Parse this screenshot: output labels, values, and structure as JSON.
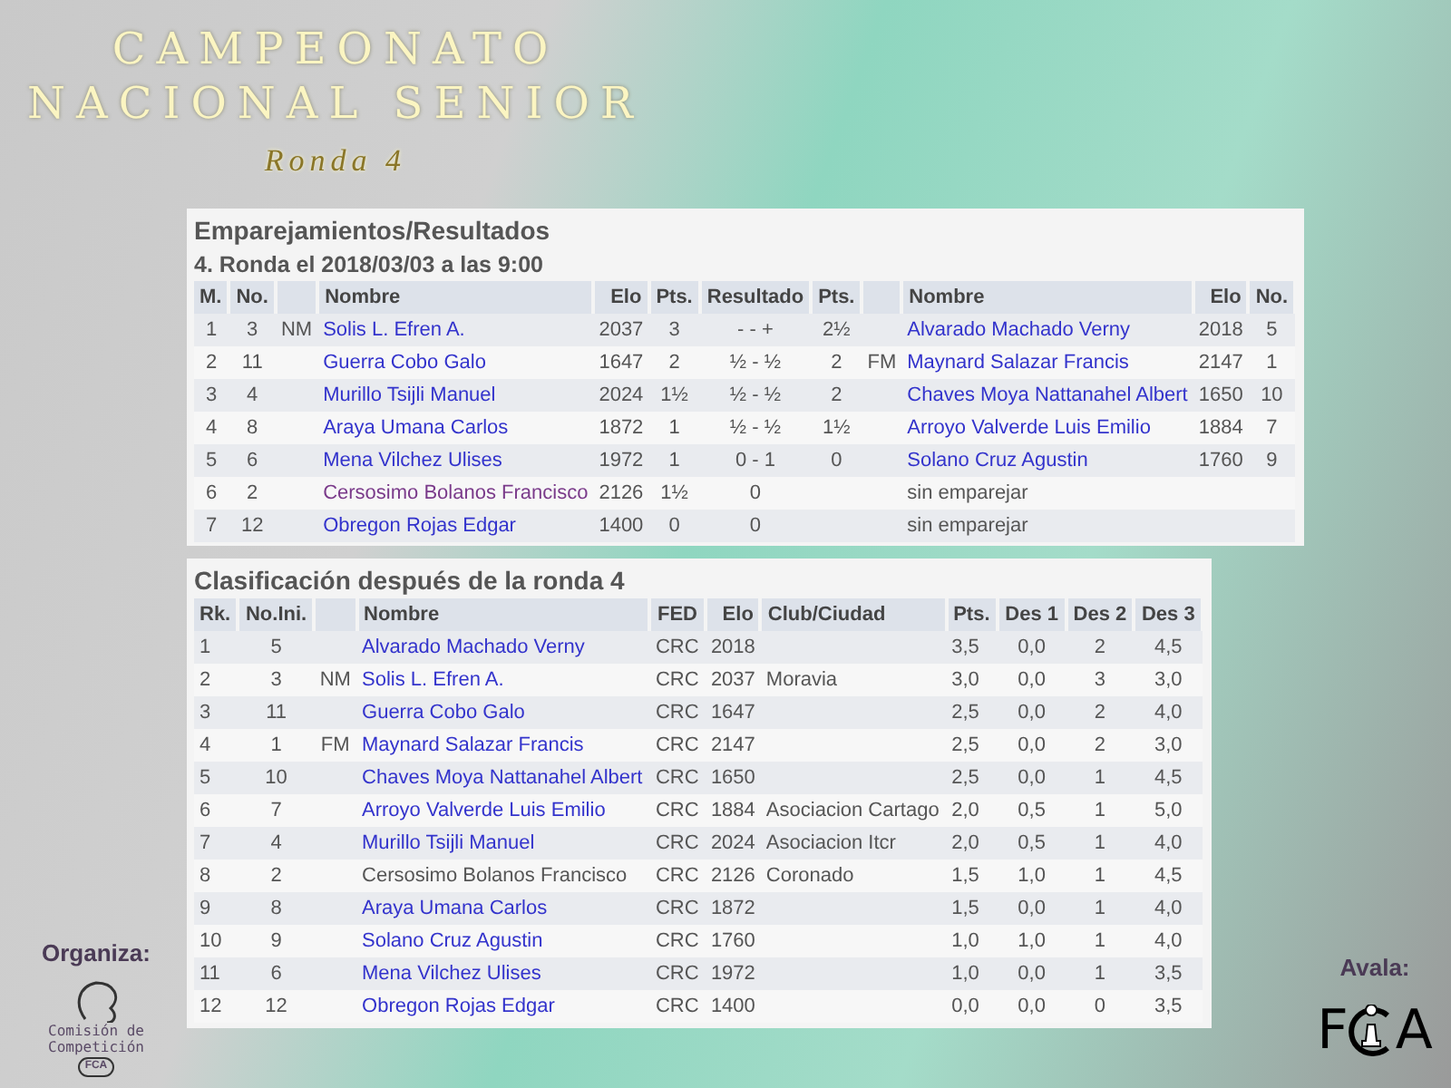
{
  "title": {
    "line1": "CAMPEONATO",
    "line2": "NACIONAL SENIOR",
    "subtitle": "Ronda 4"
  },
  "pairings": {
    "title": "Emparejamientos/Resultados",
    "subtitle": "4. Ronda el 2018/03/03 a las 9:00",
    "columns": [
      "M.",
      "No.",
      "",
      "Nombre",
      "Elo",
      "Pts.",
      "Resultado",
      "Pts.",
      "",
      "Nombre",
      "Elo",
      "No."
    ],
    "rows": [
      {
        "m": "1",
        "no": "3",
        "title": "NM",
        "name": {
          "text": "Solis L. Efren A.",
          "kind": "link"
        },
        "elo": "2037",
        "pts": "3",
        "result": "- - +",
        "pts2": "2½",
        "title2": "",
        "name2": {
          "text": "Alvarado Machado Verny",
          "kind": "link"
        },
        "elo2": "2018",
        "no2": "5"
      },
      {
        "m": "2",
        "no": "11",
        "title": "",
        "name": {
          "text": "Guerra Cobo Galo",
          "kind": "link"
        },
        "elo": "1647",
        "pts": "2",
        "result": "½ - ½",
        "pts2": "2",
        "title2": "FM",
        "name2": {
          "text": "Maynard Salazar Francis",
          "kind": "link"
        },
        "elo2": "2147",
        "no2": "1"
      },
      {
        "m": "3",
        "no": "4",
        "title": "",
        "name": {
          "text": "Murillo Tsijli Manuel",
          "kind": "link"
        },
        "elo": "2024",
        "pts": "1½",
        "result": "½ - ½",
        "pts2": "2",
        "title2": "",
        "name2": {
          "text": "Chaves Moya Nattanahel Albert",
          "kind": "link"
        },
        "elo2": "1650",
        "no2": "10"
      },
      {
        "m": "4",
        "no": "8",
        "title": "",
        "name": {
          "text": "Araya Umana Carlos",
          "kind": "link"
        },
        "elo": "1872",
        "pts": "1",
        "result": "½ - ½",
        "pts2": "1½",
        "title2": "",
        "name2": {
          "text": "Arroyo Valverde Luis Emilio",
          "kind": "link"
        },
        "elo2": "1884",
        "no2": "7"
      },
      {
        "m": "5",
        "no": "6",
        "title": "",
        "name": {
          "text": "Mena Vilchez Ulises",
          "kind": "link"
        },
        "elo": "1972",
        "pts": "1",
        "result": "0 - 1",
        "pts2": "0",
        "title2": "",
        "name2": {
          "text": "Solano Cruz Agustin",
          "kind": "link"
        },
        "elo2": "1760",
        "no2": "9"
      },
      {
        "m": "6",
        "no": "2",
        "title": "",
        "name": {
          "text": "Cersosimo Bolanos Francisco",
          "kind": "visited"
        },
        "elo": "2126",
        "pts": "1½",
        "result": "0",
        "pts2": "",
        "title2": "",
        "name2": {
          "text": "sin emparejar",
          "kind": "plain"
        },
        "elo2": "",
        "no2": ""
      },
      {
        "m": "7",
        "no": "12",
        "title": "",
        "name": {
          "text": "Obregon Rojas Edgar",
          "kind": "link"
        },
        "elo": "1400",
        "pts": "0",
        "result": "0",
        "pts2": "",
        "title2": "",
        "name2": {
          "text": "sin emparejar",
          "kind": "plain"
        },
        "elo2": "",
        "no2": ""
      }
    ]
  },
  "standings": {
    "title": "Clasificación después de la ronda 4",
    "columns": [
      "Rk.",
      "No.Ini.",
      "",
      "Nombre",
      "FED",
      "Elo",
      "Club/Ciudad",
      "Pts.",
      "Des 1",
      "Des 2",
      "Des 3"
    ],
    "rows": [
      {
        "rk": "1",
        "no": "5",
        "title": "",
        "name": {
          "text": "Alvarado Machado Verny",
          "kind": "link"
        },
        "fed": "CRC",
        "elo": "2018",
        "club": "",
        "pts": "3,5",
        "des1": "0,0",
        "des2": "2",
        "des3": "4,5"
      },
      {
        "rk": "2",
        "no": "3",
        "title": "NM",
        "name": {
          "text": "Solis L. Efren A.",
          "kind": "link"
        },
        "fed": "CRC",
        "elo": "2037",
        "club": "Moravia",
        "pts": "3,0",
        "des1": "0,0",
        "des2": "3",
        "des3": "3,0"
      },
      {
        "rk": "3",
        "no": "11",
        "title": "",
        "name": {
          "text": "Guerra Cobo Galo",
          "kind": "link"
        },
        "fed": "CRC",
        "elo": "1647",
        "club": "",
        "pts": "2,5",
        "des1": "0,0",
        "des2": "2",
        "des3": "4,0"
      },
      {
        "rk": "4",
        "no": "1",
        "title": "FM",
        "name": {
          "text": "Maynard Salazar Francis",
          "kind": "link"
        },
        "fed": "CRC",
        "elo": "2147",
        "club": "",
        "pts": "2,5",
        "des1": "0,0",
        "des2": "2",
        "des3": "3,0"
      },
      {
        "rk": "5",
        "no": "10",
        "title": "",
        "name": {
          "text": "Chaves Moya Nattanahel Albert",
          "kind": "link"
        },
        "fed": "CRC",
        "elo": "1650",
        "club": "",
        "pts": "2,5",
        "des1": "0,0",
        "des2": "1",
        "des3": "4,5"
      },
      {
        "rk": "6",
        "no": "7",
        "title": "",
        "name": {
          "text": "Arroyo Valverde Luis Emilio",
          "kind": "link"
        },
        "fed": "CRC",
        "elo": "1884",
        "club": "Asociacion Cartago",
        "pts": "2,0",
        "des1": "0,5",
        "des2": "1",
        "des3": "5,0"
      },
      {
        "rk": "7",
        "no": "4",
        "title": "",
        "name": {
          "text": "Murillo Tsijli Manuel",
          "kind": "link"
        },
        "fed": "CRC",
        "elo": "2024",
        "club": "Asociacion Itcr",
        "pts": "2,0",
        "des1": "0,5",
        "des2": "1",
        "des3": "4,0"
      },
      {
        "rk": "8",
        "no": "2",
        "title": "",
        "name": {
          "text": "Cersosimo Bolanos Francisco",
          "kind": "plain"
        },
        "fed": "CRC",
        "elo": "2126",
        "club": "Coronado",
        "pts": "1,5",
        "des1": "1,0",
        "des2": "1",
        "des3": "4,5"
      },
      {
        "rk": "9",
        "no": "8",
        "title": "",
        "name": {
          "text": "Araya Umana Carlos",
          "kind": "link"
        },
        "fed": "CRC",
        "elo": "1872",
        "club": "",
        "pts": "1,5",
        "des1": "0,0",
        "des2": "1",
        "des3": "4,0"
      },
      {
        "rk": "10",
        "no": "9",
        "title": "",
        "name": {
          "text": "Solano Cruz Agustin",
          "kind": "link"
        },
        "fed": "CRC",
        "elo": "1760",
        "club": "",
        "pts": "1,0",
        "des1": "1,0",
        "des2": "1",
        "des3": "4,0"
      },
      {
        "rk": "11",
        "no": "6",
        "title": "",
        "name": {
          "text": "Mena Vilchez Ulises",
          "kind": "link"
        },
        "fed": "CRC",
        "elo": "1972",
        "club": "",
        "pts": "1,0",
        "des1": "0,0",
        "des2": "1",
        "des3": "3,5"
      },
      {
        "rk": "12",
        "no": "12",
        "title": "",
        "name": {
          "text": "Obregon Rojas Edgar",
          "kind": "link"
        },
        "fed": "CRC",
        "elo": "1400",
        "club": "",
        "pts": "0,0",
        "des1": "0,0",
        "des2": "0",
        "des3": "3,5"
      }
    ]
  },
  "organiza": {
    "label": "Organiza:",
    "logo_lines": [
      "Comisión de",
      "Competición"
    ],
    "logo_badge": "FCA"
  },
  "avala": {
    "label": "Avala:",
    "logo_left": "F",
    "logo_right": "A"
  }
}
